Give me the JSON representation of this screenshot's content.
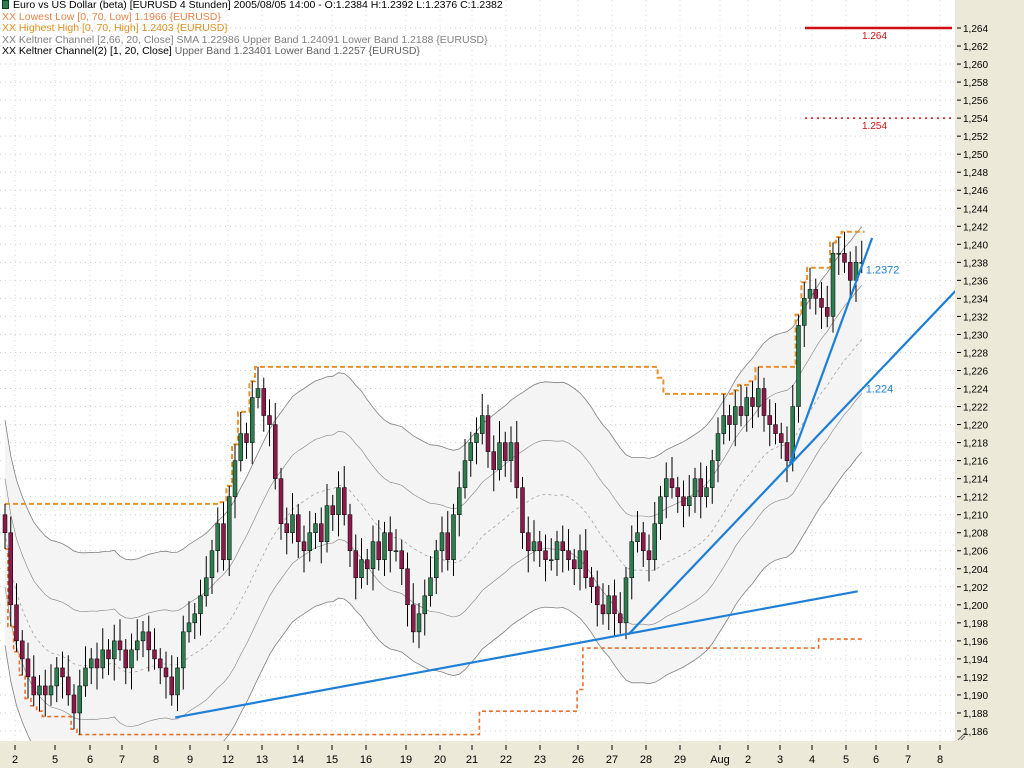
{
  "legend": {
    "title": "Euro vs US Dollar (beta) [EURUSD  4 Stunden] 2005/08/05 14:00 - O:1.2384 H:1.2392 L:1.2376 C:1.2382",
    "lowest_low": "XX Lowest Low [0, 70, Low] 1.1966 {EURUSD}",
    "highest_high": "XX Highest High [0, 70, High] 1.2403 {EURUSD}",
    "keltner1": "XX Keltner Channel [2,66, 20, Close] SMA 1.22986 Upper Band 1.24091 Lower Band 1.2188 {EURUSD}",
    "keltner2_name": "XX Keltner Channel(2) [1, 20, Close]",
    "keltner2_values": " Upper Band 1.23401 Lower Band 1.2257 {EURUSD}"
  },
  "chart_data": {
    "type": "candlestick",
    "symbol": "EURUSD",
    "timeframe": "4 Stunden",
    "ylim": [
      1.186,
      1.264
    ],
    "y_ticks": [
      "1,186",
      "1,188",
      "1,190",
      "1,192",
      "1,194",
      "1,196",
      "1,198",
      "1,200",
      "1,202",
      "1,204",
      "1,206",
      "1,208",
      "1,210",
      "1,212",
      "1,214",
      "1,216",
      "1,218",
      "1,220",
      "1,222",
      "1,224",
      "1,226",
      "1,228",
      "1,230",
      "1,232",
      "1,234",
      "1,236",
      "1,238",
      "1,240",
      "1,242",
      "1,244",
      "1,246",
      "1,248",
      "1,250",
      "1,252",
      "1,254",
      "1,256",
      "1,258",
      "1,260",
      "1,262",
      "1,264"
    ],
    "x_ticks": [
      "2",
      "5",
      "6",
      "7",
      "8",
      "9",
      "12",
      "13",
      "14",
      "15",
      "16",
      "19",
      "20",
      "21",
      "22",
      "23",
      "26",
      "27",
      "28",
      "29",
      "Aug",
      "2",
      "3",
      "4",
      "5",
      "6",
      "7",
      "8"
    ],
    "closes": [
      1.208,
      1.2,
      1.196,
      1.194,
      1.192,
      1.19,
      1.191,
      1.19,
      1.191,
      1.193,
      1.192,
      1.19,
      1.188,
      1.191,
      1.193,
      1.194,
      1.193,
      1.195,
      1.194,
      1.196,
      1.195,
      1.193,
      1.195,
      1.196,
      1.197,
      1.195,
      1.194,
      1.193,
      1.192,
      1.19,
      1.193,
      1.197,
      1.198,
      1.199,
      1.201,
      1.203,
      1.206,
      1.209,
      1.205,
      1.212,
      1.216,
      1.219,
      1.218,
      1.223,
      1.224,
      1.221,
      1.22,
      1.214,
      1.209,
      1.208,
      1.21,
      1.207,
      1.206,
      1.208,
      1.209,
      1.207,
      1.211,
      1.21,
      1.213,
      1.21,
      1.206,
      1.203,
      1.205,
      1.204,
      1.207,
      1.205,
      1.208,
      1.206,
      1.206,
      1.204,
      1.2,
      1.197,
      1.199,
      1.201,
      1.203,
      1.206,
      1.208,
      1.205,
      1.21,
      1.213,
      1.216,
      1.218,
      1.219,
      1.221,
      1.217,
      1.215,
      1.218,
      1.216,
      1.218,
      1.213,
      1.208,
      1.206,
      1.207,
      1.206,
      1.205,
      1.205,
      1.207,
      1.206,
      1.205,
      1.204,
      1.206,
      1.203,
      1.202,
      1.2,
      1.199,
      1.201,
      1.199,
      1.198,
      1.203,
      1.207,
      1.208,
      1.206,
      1.205,
      1.209,
      1.212,
      1.214,
      1.213,
      1.212,
      1.211,
      1.212,
      1.214,
      1.212,
      1.213,
      1.216,
      1.219,
      1.221,
      1.22,
      1.222,
      1.221,
      1.223,
      1.222,
      1.224,
      1.221,
      1.22,
      1.219,
      1.218,
      1.216,
      1.222,
      1.231,
      1.234,
      1.235,
      1.234,
      1.233,
      1.232,
      1.239,
      1.239,
      1.238,
      1.236,
      1.238,
      1.238
    ],
    "trendlines": [
      {
        "from": [
          29.6,
          1.1875
        ],
        "to": [
          148.3,
          1.2015
        ]
      },
      {
        "from": [
          108.4,
          1.1967
        ],
        "to": [
          166.6,
          1.2357
        ],
        "label": "1.224",
        "label_at": [
          149,
          1.224
        ]
      },
      {
        "from": [
          136.5,
          1.2157
        ],
        "to": [
          150.8,
          1.2407
        ],
        "label": "1.2372",
        "label_at": [
          149,
          1.2372
        ]
      }
    ],
    "levels": [
      {
        "price": 1.264,
        "style": "solid",
        "label": "1.264"
      },
      {
        "price": 1.254,
        "style": "dotted",
        "label": "1.254"
      }
    ],
    "colors": {
      "up": "#2e7d4f",
      "down": "#8b1a4a",
      "trend": "#1e7fd8",
      "level": "#d01010",
      "highest": "#e8902c",
      "lowest": "#e8702c",
      "band": "#808080",
      "axis_bg": "#ece9d8"
    }
  }
}
